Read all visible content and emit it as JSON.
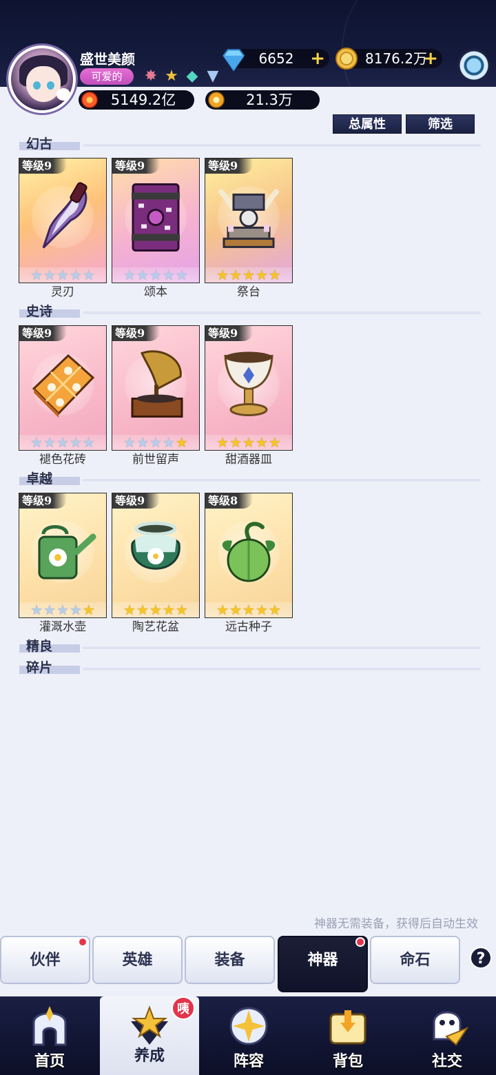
{
  "header": {
    "nickname": "盛世美颜",
    "title_badge": "可爱的",
    "rank_icons": [
      "pink-gem-icon",
      "gold-star-icon",
      "teal-diamond-icon",
      "blue-shield-icon"
    ],
    "diamonds": "6652",
    "coins": "8176.2万",
    "power": "5149.2亿",
    "stars": "21.3万"
  },
  "filters": {
    "total_attr": "总属性",
    "filter": "筛选"
  },
  "sections": [
    {
      "label": "幻古",
      "cards": [
        {
          "level": "等级9",
          "name": "灵刃",
          "stars": 0,
          "icon": "blade-icon"
        },
        {
          "level": "等级9",
          "name": "颂本",
          "stars": 0,
          "icon": "tome-icon"
        },
        {
          "level": "等级9",
          "name": "祭台",
          "stars": 5,
          "icon": "altar-icon"
        }
      ]
    },
    {
      "label": "史诗",
      "cards": [
        {
          "level": "等级9",
          "name": "褪色花砖",
          "stars": 0,
          "icon": "tile-icon"
        },
        {
          "level": "等级9",
          "name": "前世留声",
          "stars": 1,
          "icon": "gramophone-icon"
        },
        {
          "level": "等级9",
          "name": "甜酒器皿",
          "stars": 5,
          "icon": "goblet-icon"
        }
      ]
    },
    {
      "label": "卓越",
      "cards": [
        {
          "level": "等级9",
          "name": "灌溉水壶",
          "stars": 1,
          "icon": "watering-can-icon"
        },
        {
          "level": "等级9",
          "name": "陶艺花盆",
          "stars": 5,
          "icon": "flower-pot-icon"
        },
        {
          "level": "等级8",
          "name": "远古种子",
          "stars": 5,
          "icon": "seed-icon"
        }
      ]
    },
    {
      "label": "精良",
      "cards": []
    },
    {
      "label": "碎片",
      "cards": []
    }
  ],
  "hint": "神器无需装备，获得后自动生效",
  "tabs": [
    "伙伴",
    "英雄",
    "装备",
    "神器",
    "命石"
  ],
  "active_tab": "神器",
  "help_label": "?",
  "nav": {
    "home": "首页",
    "develop": "养成",
    "develop_tag": "咦",
    "lineup": "阵容",
    "bag": "背包",
    "social": "社交"
  }
}
